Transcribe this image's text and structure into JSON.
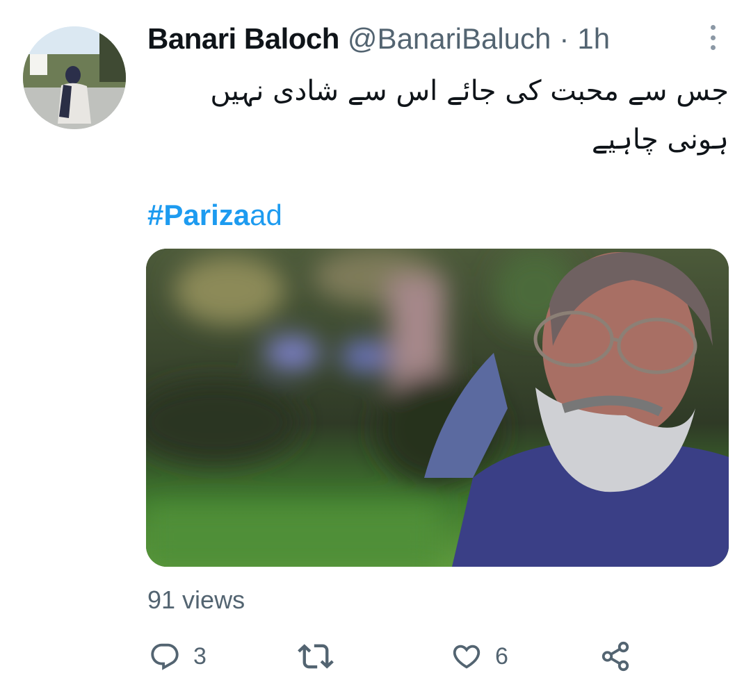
{
  "tweet": {
    "display_name": "Banari Baloch",
    "handle": "@BanariBaluch",
    "separator": "·",
    "time": "1h",
    "text": "جس سے محبت کی جائے اس سے شادی نہیں ہونی چاہیے",
    "hashtag_bold": "#Pariza",
    "hashtag_rest": "ad",
    "views": "91 views"
  },
  "actions": {
    "reply_count": "3",
    "retweet_count": "",
    "like_count": "6"
  },
  "icons": {
    "more": "more-vertical-icon",
    "reply": "reply-icon",
    "retweet": "retweet-icon",
    "like": "heart-icon",
    "share": "share-icon"
  },
  "colors": {
    "link": "#1d9bf0",
    "secondary_text": "#536471",
    "primary_text": "#0f1419"
  }
}
